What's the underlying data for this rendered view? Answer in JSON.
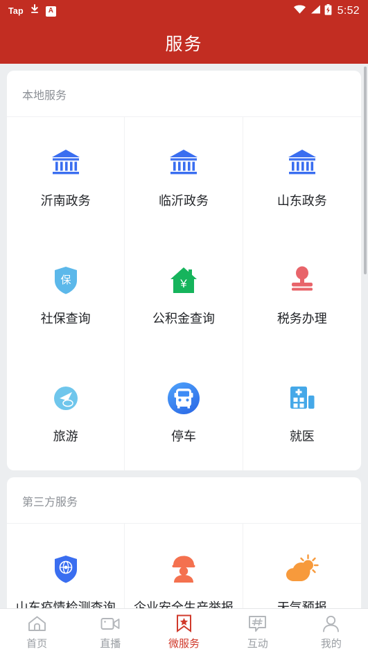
{
  "statusbar": {
    "left_text": "Tap",
    "download_icon": "download-icon",
    "app_badge": "A",
    "wifi_icon": "wifi-icon",
    "signal_icon": "signal-icon",
    "battery_icon": "battery-charging-icon",
    "time": "5:52"
  },
  "header": {
    "title": "服务"
  },
  "sections": [
    {
      "title": "本地服务",
      "items": [
        {
          "label": "沂南政务",
          "icon": "government-building-icon",
          "color": "#3a6ef0"
        },
        {
          "label": "临沂政务",
          "icon": "government-building-icon",
          "color": "#3a6ef0"
        },
        {
          "label": "山东政务",
          "icon": "government-building-icon",
          "color": "#3a6ef0"
        },
        {
          "label": "社保查询",
          "icon": "shield-insurance-icon",
          "color": "#5cb8ea"
        },
        {
          "label": "公积金查询",
          "icon": "house-yuan-icon",
          "color": "#16b45c"
        },
        {
          "label": "税务办理",
          "icon": "stamp-icon",
          "color": "#e8646a"
        },
        {
          "label": "旅游",
          "icon": "travel-plane-icon",
          "color": "#6fc6ec"
        },
        {
          "label": "停车",
          "icon": "bus-parking-icon",
          "color": "#3d8bf5"
        },
        {
          "label": "就医",
          "icon": "hospital-icon",
          "color": "#45a8e8"
        }
      ]
    },
    {
      "title": "第三方服务",
      "items": [
        {
          "label": "山东疫情检测查询",
          "icon": "shield-globe-icon",
          "color": "#3a6ef0"
        },
        {
          "label": "企业安全生产举报",
          "icon": "worker-helmet-icon",
          "color": "#f4714f"
        },
        {
          "label": "天气预报",
          "icon": "sun-cloud-icon",
          "color": "#f79a3c"
        }
      ]
    }
  ],
  "tabbar": {
    "items": [
      {
        "label": "首页",
        "icon": "home-icon",
        "active": false
      },
      {
        "label": "直播",
        "icon": "video-camera-icon",
        "active": false
      },
      {
        "label": "微服务",
        "icon": "bookmark-star-icon",
        "active": true
      },
      {
        "label": "互动",
        "icon": "hash-chat-icon",
        "active": false
      },
      {
        "label": "我的",
        "icon": "user-icon",
        "active": false
      }
    ]
  },
  "colors": {
    "brand_red": "#c22d22",
    "active_red": "#d0392b",
    "page_bg": "#eceef0",
    "card_bg": "#ffffff",
    "muted_text": "#8c9096"
  }
}
